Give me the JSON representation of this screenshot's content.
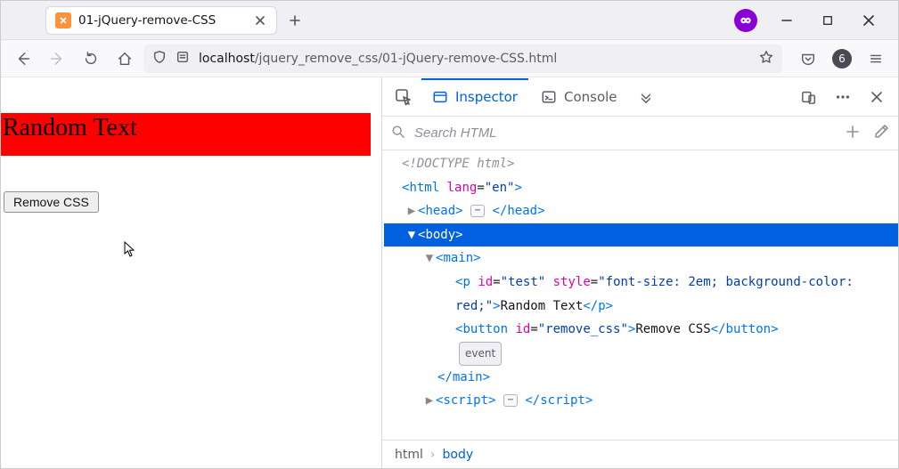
{
  "titlebar": {
    "tab_title": "01-jQuery-remove-CSS"
  },
  "navbar": {
    "url_host": "localhost",
    "url_path": "/jquery_remove_css/01-jQuery-remove-CSS.html",
    "counter": "6"
  },
  "page": {
    "random_text": "Random Text",
    "remove_css_label": "Remove CSS"
  },
  "devtools": {
    "tabs": {
      "inspector": "Inspector",
      "console": "Console"
    },
    "search_placeholder": "Search HTML",
    "doctype": "<!DOCTYPE html>",
    "html_lang_attr": "lang",
    "html_lang_val": "\"en\"",
    "head_tag": "head",
    "body_tag": "body",
    "main_tag": "main",
    "p_tag": "p",
    "p_id_attr": "id",
    "p_id_val": "\"test\"",
    "p_style_attr": "style",
    "p_style_val": "\"font-size: 2em; background-color: red;\"",
    "p_text": "Random Text",
    "button_tag": "button",
    "button_id_attr": "id",
    "button_id_val": "\"remove_css\"",
    "button_text": "Remove CSS",
    "event_label": "event",
    "script_tag": "script",
    "crumbs": {
      "html": "html",
      "body": "body"
    }
  }
}
